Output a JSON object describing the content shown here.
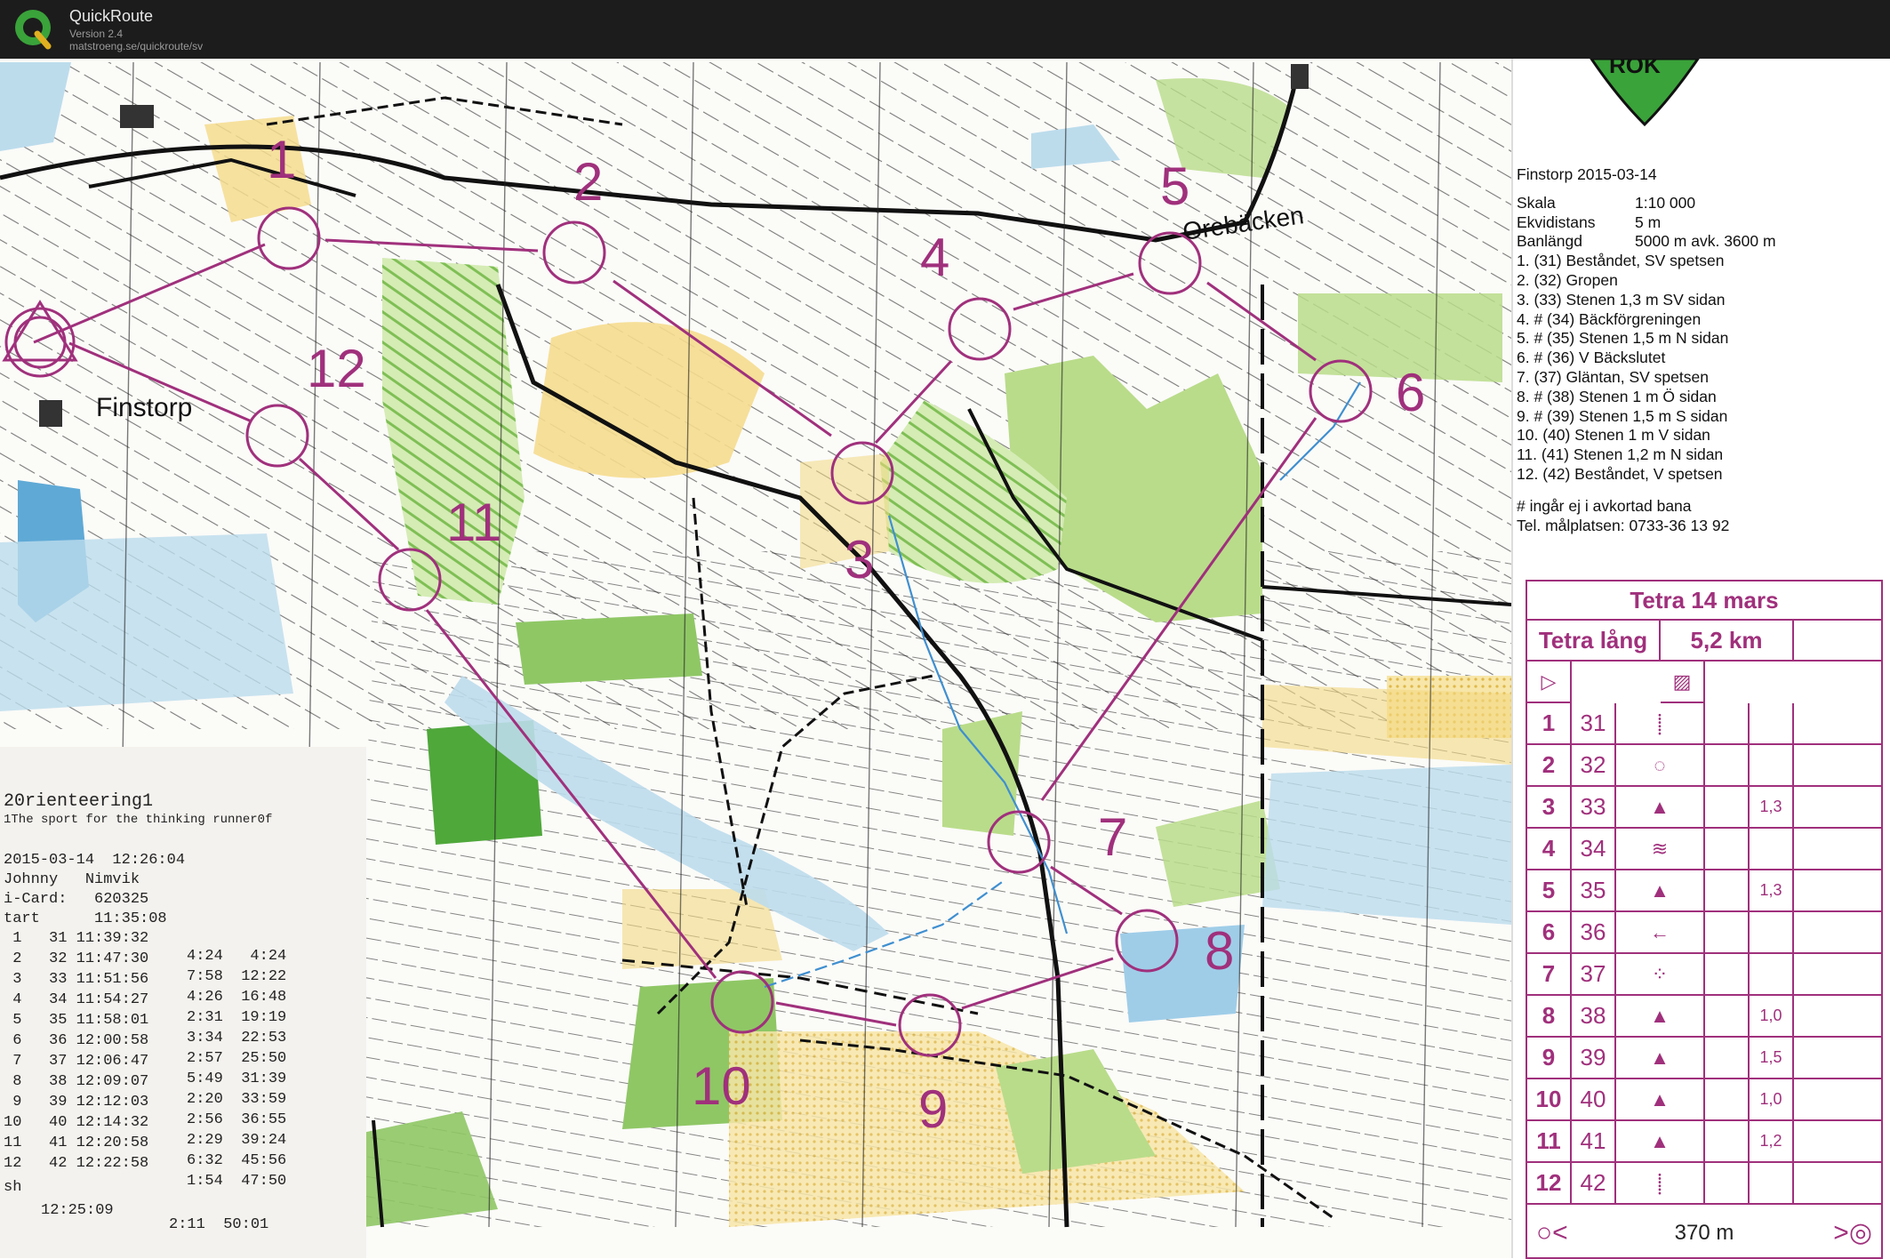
{
  "app": {
    "name": "QuickRoute",
    "version": "Version 2.4",
    "url": "matstroeng.se/quickroute/sv"
  },
  "map": {
    "place_labels": {
      "finstorp": "Finstorp",
      "orebacken": "Orebäcken",
      "club_logo": "ROK"
    },
    "controls": [
      {
        "num": "1"
      },
      {
        "num": "2"
      },
      {
        "num": "3"
      },
      {
        "num": "4"
      },
      {
        "num": "5"
      },
      {
        "num": "6"
      },
      {
        "num": "7"
      },
      {
        "num": "8"
      },
      {
        "num": "9"
      },
      {
        "num": "10"
      },
      {
        "num": "11"
      },
      {
        "num": "12"
      }
    ],
    "colors": {
      "course": "#a0307c",
      "forest_white": "#ffffff",
      "green_light": "#b9dc8a",
      "green_mid": "#8fc765",
      "green_dark": "#4fa83a",
      "open_yellow": "#f3d982",
      "water_blue": "#9fcde8",
      "marsh_blue": "#bcdcec"
    }
  },
  "legend": {
    "title": "Finstorp 2015-03-14",
    "rows": [
      {
        "label": "Skala",
        "value": "1:10 000"
      },
      {
        "label": "Ekvidistans",
        "value": "5 m"
      },
      {
        "label": "Banlängd",
        "value": "5000 m avk. 3600 m"
      }
    ],
    "controls": [
      "1.    (31) Beståndet, SV spetsen",
      "2.    (32) Gropen",
      "3.    (33) Stenen 1,3 m SV sidan",
      "4. # (34) Bäckförgreningen",
      "5. # (35) Stenen 1,5 m N sidan",
      "6. # (36) V Bäckslutet",
      "7.    (37) Gläntan, SV spetsen",
      "8. # (38) Stenen 1 m Ö sidan",
      "9. # (39) Stenen 1,5 m S sidan",
      "10.  (40) Stenen 1 m V sidan",
      "11.  (41) Stenen 1,2 m N sidan",
      "12.  (42) Beståndet, V spetsen"
    ],
    "note": "# ingår ej i avkortad bana",
    "phone": "Tel. målplatsen: 0733-36 13 92"
  },
  "description_sheet": {
    "event": "Tetra 14 mars",
    "course": "Tetra lång",
    "length": "5,2 km",
    "start_symbol": "triangle",
    "rows": [
      {
        "num": "1",
        "code": "31",
        "detail": "",
        "icon": "⸽"
      },
      {
        "num": "2",
        "code": "32",
        "detail": "",
        "icon": "◌"
      },
      {
        "num": "3",
        "code": "33",
        "detail": "1,3",
        "icon": "▲"
      },
      {
        "num": "4",
        "code": "34",
        "detail": "",
        "icon": "≋"
      },
      {
        "num": "5",
        "code": "35",
        "detail": "1,3",
        "icon": "▲"
      },
      {
        "num": "6",
        "code": "36",
        "detail": "",
        "icon": "←"
      },
      {
        "num": "7",
        "code": "37",
        "detail": "",
        "icon": "⁘"
      },
      {
        "num": "8",
        "code": "38",
        "detail": "1,0",
        "icon": "▲"
      },
      {
        "num": "9",
        "code": "39",
        "detail": "1,5",
        "icon": "▲"
      },
      {
        "num": "10",
        "code": "40",
        "detail": "1,0",
        "icon": "▲"
      },
      {
        "num": "11",
        "code": "41",
        "detail": "1,2",
        "icon": "▲"
      },
      {
        "num": "12",
        "code": "42",
        "detail": "",
        "icon": "⸽"
      }
    ],
    "finish_distance": "370 m"
  },
  "receipt": {
    "header1": "20rienteering1",
    "header2": "1The sport for the thinking runner0f",
    "datetime": "2015-03-14  12:26:04",
    "name": "Johnny   Nimvik",
    "card": "i-Card:   620325",
    "start": "tart      11:35:08",
    "splits": [
      {
        "left": " 1   31 11:39:32",
        "right": "4:24   4:24"
      },
      {
        "left": " 2   32 11:47:30",
        "right": "7:58  12:22"
      },
      {
        "left": " 3   33 11:51:56",
        "right": "4:26  16:48"
      },
      {
        "left": " 4   34 11:54:27",
        "right": "2:31  19:19"
      },
      {
        "left": " 5   35 11:58:01",
        "right": "3:34  22:53"
      },
      {
        "left": " 6   36 12:00:58",
        "right": "2:57  25:50"
      },
      {
        "left": " 7   37 12:06:47",
        "right": "5:49  31:39"
      },
      {
        "left": " 8   38 12:09:07",
        "right": "2:20  33:59"
      },
      {
        "left": " 9   39 12:12:03",
        "right": "2:56  36:55"
      },
      {
        "left": "10   40 12:14:32",
        "right": "2:29  39:24"
      },
      {
        "left": "11   41 12:20:58",
        "right": "6:32  45:56"
      },
      {
        "left": "12   42 12:22:58",
        "right": "1:54  47:50"
      }
    ],
    "finish_label": "sh",
    "finish_time": "12:25:09",
    "finish_split": "2:11  50:01"
  }
}
